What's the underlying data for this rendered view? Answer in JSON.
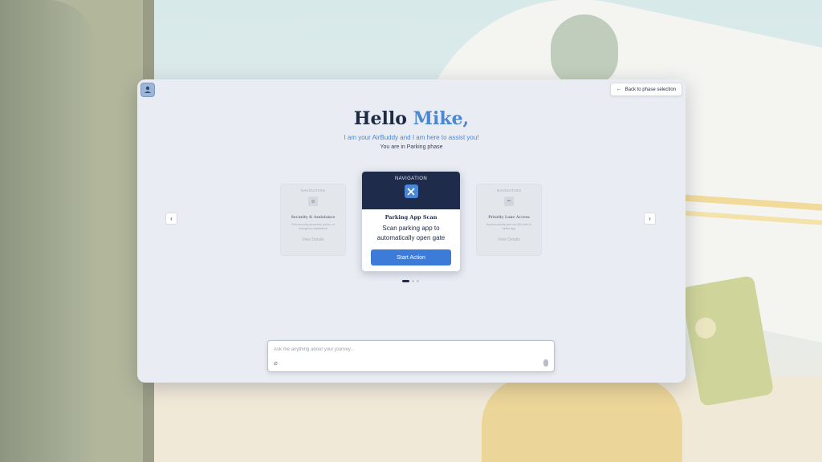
{
  "header": {
    "back_label": "Back to phase selection",
    "back_icon": "arrow-left-icon",
    "logo_icon": "airbuddy-logo-icon"
  },
  "hero": {
    "greeting_prefix": "Hello",
    "user_name": "Mike,",
    "subtitle": "I am your AirBuddy and I am here to assist you!",
    "phase_text": "You are in Parking phase"
  },
  "carousel": {
    "prev_icon": "chevron-left-icon",
    "next_icon": "chevron-right-icon",
    "active_index": 0,
    "dot_count": 3,
    "cards": {
      "left": {
        "category": "NAVIGATION",
        "title": "Security & Assistance",
        "description": "Find security personnel, police, or emergency assistance",
        "action_label": "View Details",
        "icon": "compass-icon"
      },
      "center": {
        "category": "NAVIGATION",
        "title": "Parking App Scan",
        "description": "Scan parking app to automatically open gate",
        "action_label": "Start Action",
        "icon": "tools-icon"
      },
      "right": {
        "category": "NAVIGATION",
        "title": "Priority Lane Access",
        "description": "Access priority lane via QR code in airline app",
        "action_label": "View Details",
        "icon": "qr-icon"
      }
    }
  },
  "chat": {
    "placeholder": "Ask me anything about your journey...",
    "value": "",
    "attach_icon": "paperclip-icon",
    "mic_icon": "microphone-icon"
  },
  "colors": {
    "accent": "#3d7bd8",
    "name_blue": "#4b86d1",
    "card_header": "#1e2b4a",
    "dialog_bg": "#e9edf3"
  }
}
